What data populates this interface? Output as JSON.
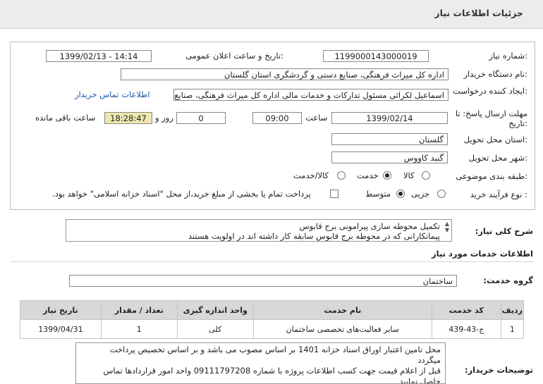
{
  "page": {
    "title": "جزئیات اطلاعات نیاز"
  },
  "form": {
    "need_number_label": "شماره نیاز:",
    "need_number": "1199000143000019",
    "announce_label": "تاریخ و ساعت اعلان عمومی:",
    "announce_value": "1399/02/13 - 14:14",
    "buyer_label": "نام دستگاه خریدار:",
    "buyer_value": "اداره کل میراث فرهنگی، صنایع دستی و گردشگری استان گلستان",
    "creator_label": "ایجاد کننده درخواست:",
    "creator_value": "اسماعیل لکرائی مسئول تدارکات و خدمات مالی اداره کل میراث فرهنگی، صنایع",
    "contact_link": "اطلاعات تماس خریدار",
    "deadline_label": "مهلت ارسال پاسخ: تا تاریخ:",
    "deadline_date": "1399/02/14",
    "time_label": "ساعت",
    "deadline_time": "09:00",
    "days_value": "0",
    "days_label": "روز و",
    "remaining_time": "18:28:47",
    "remaining_label": "ساعت باقی مانده",
    "province_label": "استان محل تحویل:",
    "province_value": "گلستان",
    "city_label": "شهر محل تحویل:",
    "city_value": "گنبد کاووس",
    "category_label": "طبقه بندی موضوعی:",
    "category_options": [
      "کالا",
      "خدمت",
      "کالا/خدمت"
    ],
    "category_selected": "خدمت",
    "process_label": "نوع فرآیند خرید :",
    "process_options": [
      "جزیی",
      "متوسط"
    ],
    "process_selected": "متوسط",
    "payment_note": "پرداخت تمام یا بخشی از مبلغ خرید،از محل \"اسناد خزانه اسلامی\" خواهد بود."
  },
  "description": {
    "label": "شرح کلی نیاز:",
    "line1": "تکمیل محوطه سازی پیرامونی برج قابوس",
    "line2": "پیمانکارانی که در محوطه برج قابوس سابقه کار داشته اند در اولویت هستند"
  },
  "services": {
    "section_title": "اطلاعات خدمات مورد نیاز",
    "group_label": "گروه خدمت:",
    "group_value": "ساختمان",
    "columns": [
      "ردیف",
      "کد خدمت",
      "نام خدمت",
      "واحد اندازه گیری",
      "تعداد / مقدار",
      "تاریخ نیاز"
    ],
    "rows": [
      {
        "row": "1",
        "code": "ج-43-439",
        "name": "سایر فعالیت‌های تخصصی ساختمان",
        "unit": "کلی",
        "qty": "1",
        "date": "1399/04/31"
      }
    ]
  },
  "notes": {
    "label": "توضیحات خریدار:",
    "line1": "محل تامین اعتبار اوراق اسناد خزانه 1401 بر اساس مصوب می باشد و بر اساس تخصیص پرداخت",
    "line2": "میگردد",
    "line3": "قبل از اعلام قیمت جهت کسب اطلاعات پروژه با شماره 09111797208 واحد امور قراردادها تماس",
    "line4": "حاصل نمایید"
  },
  "colors": {
    "link": "#1a5aa8",
    "remaining_bg": "#efe7b0",
    "table_header": "#d8d8d8"
  }
}
